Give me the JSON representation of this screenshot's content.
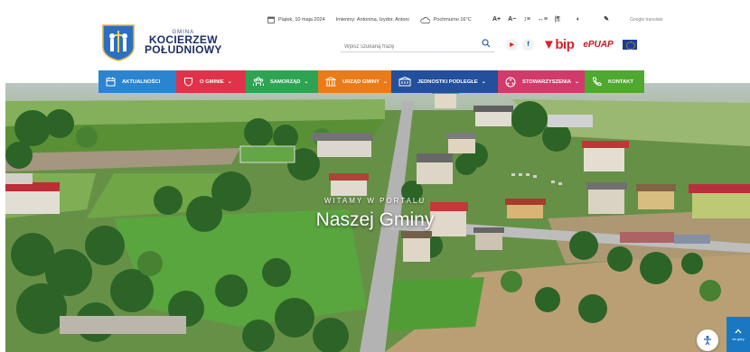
{
  "logo": {
    "small": "GMINA",
    "line1": "KOCIERZEW",
    "line2": "POŁUDNIOWY"
  },
  "infobar": {
    "date": "Piątek, 10 maja 2024",
    "nameday": "Imieniny: Antonina, Izydor, Antoni",
    "weather": "Pochmurno 16°C"
  },
  "tools": {
    "a_plus": "A+",
    "a_minus": "A−",
    "google": "Google translate"
  },
  "search": {
    "placeholder": "Wpisz szukaną frazę"
  },
  "social": {
    "youtube": "▶",
    "facebook": "f",
    "bip": "bip",
    "epuap": "ePUAP"
  },
  "nav": [
    {
      "label": "AKTUALNOŚCI",
      "color": "#2b84d0",
      "icon": "calendar-icon",
      "caret": false
    },
    {
      "label": "O GMINIE",
      "color": "#e0334a",
      "icon": "shield-icon",
      "caret": true
    },
    {
      "label": "SAMORZĄD",
      "color": "#2ea352",
      "icon": "people-icon",
      "caret": true
    },
    {
      "label": "URZĄD GMINY",
      "color": "#ea7b18",
      "icon": "building-icon",
      "caret": true
    },
    {
      "label": "JEDNOSTKI PODLEGŁE",
      "color": "#234f9c",
      "icon": "institution-icon",
      "caret": true
    },
    {
      "label": "STOWARZYSZENIA",
      "color": "#d13a6a",
      "icon": "network-icon",
      "caret": true
    },
    {
      "label": "KONTAKT",
      "color": "#4fa82f",
      "icon": "phone-icon",
      "caret": false
    }
  ],
  "hero": {
    "subtitle": "WITAMY W PORTALU",
    "title": "Naszej Gminy"
  },
  "scroll_top": {
    "label": "do góry"
  }
}
